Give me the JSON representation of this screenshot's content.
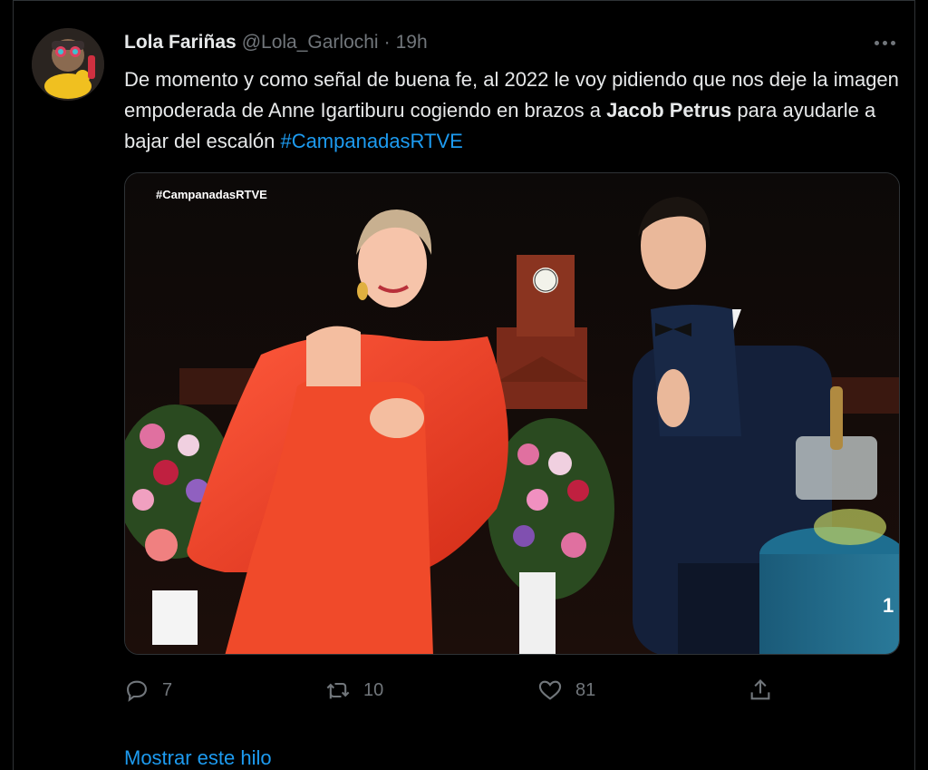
{
  "author": {
    "name": "Lola Fariñas",
    "handle": "@Lola_Garlochi",
    "separator": "·",
    "time": "19h"
  },
  "tweet": {
    "text_part1": "De momento y como señal de buena fe, al 2022 le voy pidiendo que nos deje la imagen empoderada de Anne Igartiburu cogiendo en brazos a ",
    "bold_name": "Jacob Petrus",
    "text_part2": " para ayudarle a bajar del escalón ",
    "hashtag": "#CampanadasRTVE"
  },
  "media": {
    "watermark": "#CampanadasRTVE",
    "channel_badge": "1"
  },
  "actions": {
    "replies": "7",
    "retweets": "10",
    "likes": "81"
  },
  "thread_link": "Mostrar este hilo",
  "colors": {
    "background": "#000000",
    "text": "#e7e9ea",
    "secondary": "#71767b",
    "accent": "#1d9bf0",
    "border": "#2f3336"
  },
  "icons": {
    "reply": "reply-icon",
    "retweet": "retweet-icon",
    "like": "heart-icon",
    "share": "share-icon",
    "more": "more-icon"
  }
}
